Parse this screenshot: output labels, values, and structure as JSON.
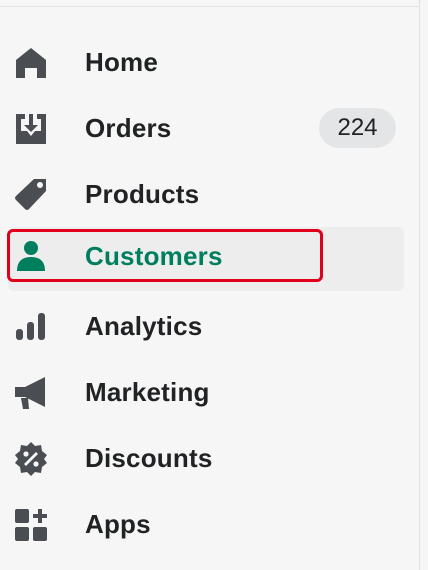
{
  "nav": {
    "items": [
      {
        "label": "Home",
        "icon": "home-icon"
      },
      {
        "label": "Orders",
        "icon": "orders-icon",
        "badge": "224"
      },
      {
        "label": "Products",
        "icon": "tag-icon"
      },
      {
        "label": "Customers",
        "icon": "person-icon",
        "active": true
      },
      {
        "label": "Analytics",
        "icon": "bar-chart-icon"
      },
      {
        "label": "Marketing",
        "icon": "megaphone-icon"
      },
      {
        "label": "Discounts",
        "icon": "discount-icon"
      },
      {
        "label": "Apps",
        "icon": "apps-icon"
      }
    ]
  },
  "colors": {
    "icon": "#4a4d51",
    "active_text": "#007f5f",
    "highlight_border": "#e0001b",
    "badge_bg": "#e4e5e7"
  }
}
